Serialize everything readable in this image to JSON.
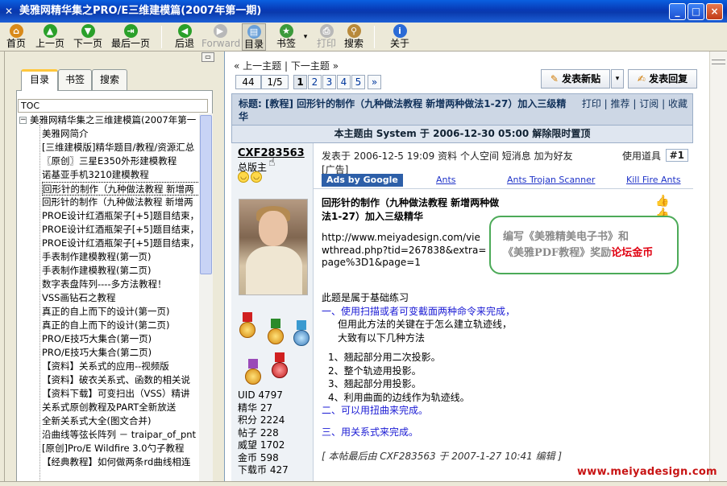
{
  "window": {
    "title": "美雅网精华集之PRO/E三维建模篇(2007年第一期)",
    "min_label": "_",
    "max_label": "□",
    "close_label": "×"
  },
  "toolbar": [
    {
      "label": "首页",
      "icon": "home-icon",
      "color": "#d98a1a",
      "glyph": "⌂",
      "enabled": true
    },
    {
      "label": "上一页",
      "icon": "up-arrow-icon",
      "color": "#2aa02a",
      "glyph": "▲",
      "enabled": true
    },
    {
      "label": "下一页",
      "icon": "down-arrow-icon",
      "color": "#2aa02a",
      "glyph": "▼",
      "enabled": true
    },
    {
      "label": "最后一页",
      "icon": "last-page-icon",
      "color": "#2aa02a",
      "glyph": "⇥",
      "enabled": true
    },
    {
      "label": "后退",
      "icon": "back-arrow-icon",
      "color": "#2aa02a",
      "glyph": "◀",
      "enabled": true
    },
    {
      "label": "Forward",
      "icon": "forward-arrow-icon",
      "color": "#b8b8b8",
      "glyph": "▶",
      "enabled": false
    },
    {
      "label": "目录",
      "icon": "contents-icon",
      "color": "#6aa0d8",
      "glyph": "▤",
      "enabled": true
    },
    {
      "label": "书签",
      "icon": "bookmark-icon",
      "color": "#3b9a3b",
      "glyph": "★",
      "enabled": true
    },
    {
      "label": "打印",
      "icon": "print-icon",
      "color": "#b8b8b8",
      "glyph": "⎙",
      "enabled": false
    },
    {
      "label": "搜索",
      "icon": "search-icon",
      "color": "#b88a3b",
      "glyph": "⚲",
      "enabled": true
    },
    {
      "label": "关于",
      "icon": "info-icon",
      "color": "#2b6bd6",
      "glyph": "i",
      "enabled": true
    }
  ],
  "sidebar": {
    "tabs": [
      {
        "label": "目录",
        "active": true
      },
      {
        "label": "书签",
        "active": false
      },
      {
        "label": "搜索",
        "active": false
      }
    ],
    "toc_header": "TOC",
    "root": "美雅网精华集之三维建模篇(2007年第一",
    "items": [
      "美雅网简介",
      "[三维建模版]精华题目/教程/资源汇总",
      "〖原创〗三星E350外形建模教程",
      "诺基亚手机3210建模教程",
      "回形针的制作（九种做法教程 新增两",
      "回形针的制作（九种做法教程 新增两",
      "PROE设计红酒瓶架子[+5]题目结束，",
      "PROE设计红酒瓶架子[+5]题目结束，",
      "PROE设计红酒瓶架子[+5]题目结束，",
      "手表制作建模教程(第一页)",
      "手表制作建模教程(第二页)",
      "数字表盘阵列----多方法教程！",
      "VSS画钻石之教程",
      "真正的自上而下的设计(第一页)",
      "真正的自上而下的设计(第二页)",
      "PRO/E技巧大集合(第一页)",
      "PRO/E技巧大集合(第二页)",
      "【资料】关系式的应用--视频版",
      "【资料】破衣关系式、函数的相关说",
      "【资料下载】可变扫出（VSS）精讲",
      "关系式原创教程及PART全新放送",
      "全新关系式大全(图文合并)",
      "沿曲线等弦长阵列 － traipar_of_pnt 的",
      "[原创]Pro/E Wildfire 3.0勺子教程",
      "【经典教程】如何做两条rd曲线相连"
    ]
  },
  "topic_nav": {
    "prev": "« 上一主题",
    "sep": "|",
    "next": "下一主题 »"
  },
  "pager": {
    "total": "44",
    "pages": "1/5",
    "numbers": [
      "1",
      "2",
      "3",
      "4",
      "5"
    ],
    "current": "1",
    "more": "»"
  },
  "buttons": {
    "new_post": "发表新贴",
    "reply": "发表回复",
    "dropdown": "▾"
  },
  "thread": {
    "title": "标题: [教程] 回形针的制作（九种做法教程 新增两种做法1-27）加入三级精华",
    "tools": [
      "打印",
      "推荐",
      "订阅",
      "收藏"
    ],
    "tools_sep": "|",
    "sticky_notice": "本主题由 System 于 2006-12-30 05:00 解除限时置顶"
  },
  "post": {
    "author": "CXF283563",
    "rank": "总版主",
    "meta": "发表于 2006-12-5 19:09  资料  个人空间  短消息  加为好友",
    "tools": "使用道具",
    "floor": "#1",
    "ad_label": "[广告]",
    "ads": {
      "label": "Ads by Google",
      "links": [
        "Ants",
        "Ants Trojan Scanner",
        "Kill Fire Ants"
      ]
    },
    "title": "回形针的制作（九种做法教程 新增两种做法1-27）加入三级精华",
    "url": "http://www.meiyadesign.com/viewthread.php?tid=267838&extra=page%3D1&page=1",
    "promo_line1": "编写《美雅精美电子书》和",
    "promo_line2": "《美雅PDF教程》奖励",
    "promo_red": "论坛金币",
    "body": {
      "intro": "此题是属于基础练习",
      "step1": "一、使用扫描或者可变截面两种命令来完成，",
      "step1_note1": "但用此方法的关键在于怎么建立轨迹线，",
      "step1_note2": "大致有以下几种方法",
      "methods": [
        "1、翘起部分用二次投影。",
        "2、整个轨迹用投影。",
        "3、翘起部分用投影。",
        "4、利用曲面的边线作为轨迹线。"
      ],
      "step2": "二、可以用扭曲来完成。",
      "step3": "三、用关系式来完成。"
    },
    "edit_note": "[ 本帖最后由 CXF283563 于 2007-1-27 10:41 编辑 ]",
    "stats": [
      "UID 4797",
      "精华 27",
      "积分 2224",
      "帖子 228",
      "威望 1702",
      "金币 598",
      "下载币 427"
    ]
  },
  "watermark": "www.meiyadesign.com",
  "colors": {
    "title_bar": "#0839b4",
    "thread_head": "#cdd7e5",
    "promo_border": "#4caa58",
    "promo_red": "#e00010",
    "body_blue": "#1b1bd4",
    "watermark": "#c81414"
  }
}
